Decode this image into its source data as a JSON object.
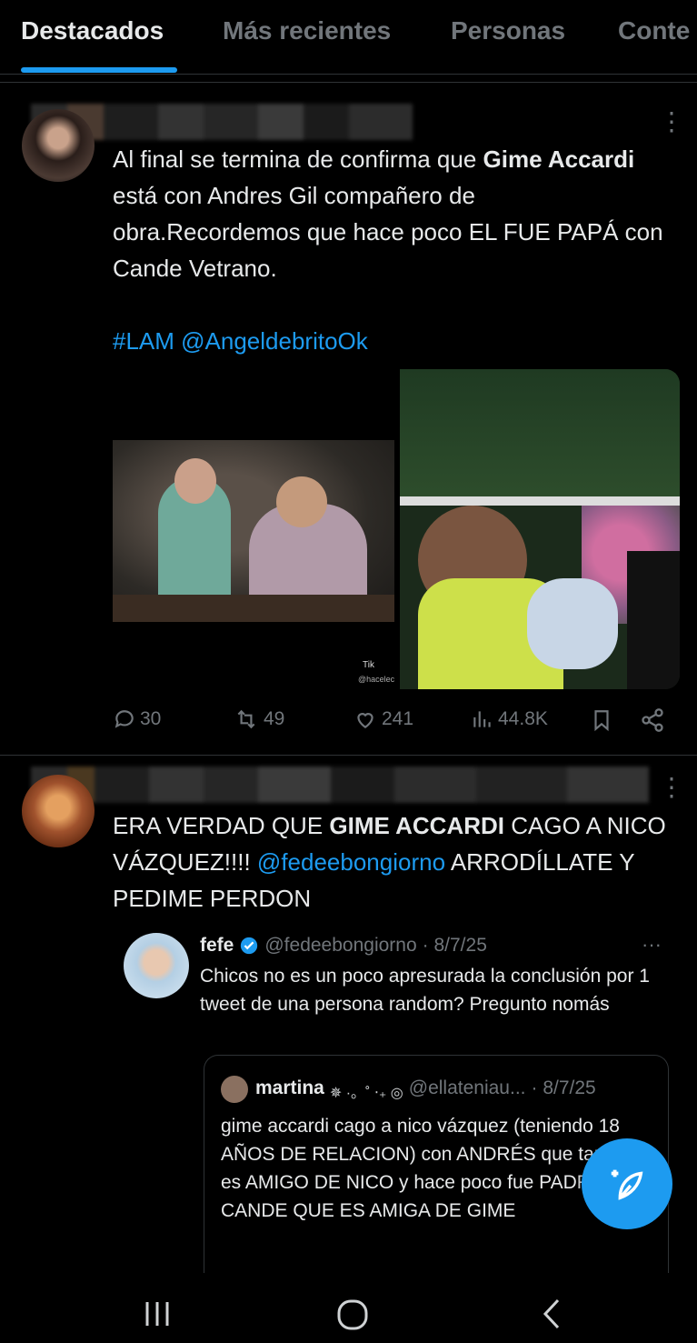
{
  "tabs": [
    {
      "label": "Destacados",
      "active": true
    },
    {
      "label": "Más recientes",
      "active": false
    },
    {
      "label": "Personas",
      "active": false
    },
    {
      "label": "Conte",
      "active": false
    }
  ],
  "tweet1": {
    "text_a": "Al final se termina de confirma que ",
    "text_bold": "Gime Accardi",
    "text_b": " está con Andres Gil compañero de obra.Recordemos que hace poco EL FUE PAPÁ con Cande Vetrano.",
    "hashtag": "#LAM",
    "mention": "@AngeldebritoOk",
    "replies": "30",
    "reposts": "49",
    "likes": "241",
    "views": "44.8K",
    "media_watermark": "Tik",
    "media_handle": "@hacelect"
  },
  "tweet2": {
    "text_a": "ERA VERDAD QUE ",
    "text_bold": "GIME ACCARDI",
    "text_b": " CAGO A NICO VÁZQUEZ!!!! ",
    "mention": "@fedeebongiorno",
    "text_c": " ARRODÍLLATE Y PEDIME PERDON"
  },
  "quote": {
    "name": "fefe",
    "handle": "@fedeebongiorno",
    "date": "· 8/7/25",
    "text": "Chicos no es un poco apresurada la conclusión por 1 tweet de una persona random? Pregunto nomás"
  },
  "inner_quote": {
    "name": "martina",
    "name_deco": "✵ ·。˚ ‧₊ ◎",
    "handle": "@ellateniau...",
    "date": "· 8/7/25",
    "text": "gime accardi cago a nico vázquez (teniendo 18 AÑOS DE RELACION) con ANDRÉS que también es AMIGO DE NICO y hace poco fue PADRE con CANDE QUE ES AMIGA DE GIME"
  },
  "colors": {
    "accent": "#1d9bf0",
    "background": "#000000",
    "text": "#e7e9ea",
    "muted": "#71767b"
  },
  "icons": [
    "reply-icon",
    "repost-icon",
    "like-icon",
    "views-icon",
    "bookmark-icon",
    "share-icon",
    "compose-icon",
    "verified-icon",
    "more-icon"
  ]
}
